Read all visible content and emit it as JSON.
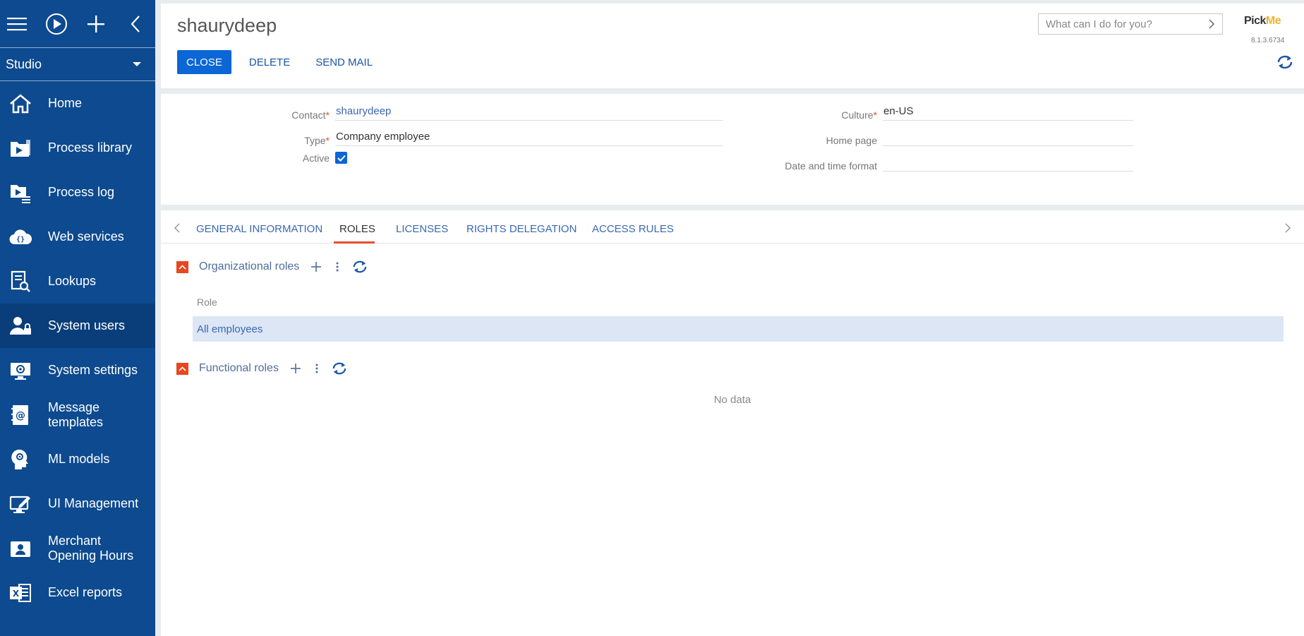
{
  "sidebar": {
    "studio_label": "Studio",
    "items": [
      {
        "label": "Home",
        "icon": "home-icon"
      },
      {
        "label": "Process library",
        "icon": "process-library-icon"
      },
      {
        "label": "Process log",
        "icon": "process-log-icon"
      },
      {
        "label": "Web services",
        "icon": "web-services-icon"
      },
      {
        "label": "Lookups",
        "icon": "lookups-icon"
      },
      {
        "label": "System users",
        "icon": "system-users-icon"
      },
      {
        "label": "System settings",
        "icon": "system-settings-icon"
      },
      {
        "label": "Message\ntemplates",
        "icon": "message-templates-icon"
      },
      {
        "label": "ML models",
        "icon": "ml-models-icon"
      },
      {
        "label": "UI Management",
        "icon": "ui-management-icon"
      },
      {
        "label": "Merchant\nOpening Hours",
        "icon": "merchant-hours-icon"
      },
      {
        "label": "Excel reports",
        "icon": "excel-reports-icon"
      }
    ],
    "active_item": "System users"
  },
  "header": {
    "title": "shaurydeep",
    "close_label": "CLOSE",
    "delete_label": "DELETE",
    "send_mail_label": "SEND MAIL",
    "search_placeholder": "What can I do for you?",
    "brand_prefix": "Pick",
    "brand_suffix": "Me",
    "version": "8.1.3.6734"
  },
  "form": {
    "contact_label": "Contact",
    "contact_value": "shaurydeep",
    "type_label": "Type",
    "type_value": "Company employee",
    "active_label": "Active",
    "active_checked": true,
    "culture_label": "Culture",
    "culture_value": "en-US",
    "home_page_label": "Home page",
    "home_page_value": "",
    "datetime_label": "Date and time format",
    "datetime_value": "",
    "required_mark": "*"
  },
  "tabs": {
    "items": [
      "GENERAL INFORMATION",
      "ROLES",
      "LICENSES",
      "RIGHTS DELEGATION",
      "ACCESS RULES"
    ],
    "active": "ROLES"
  },
  "roles": {
    "org_title": "Organizational roles",
    "org_column": "Role",
    "org_rows": [
      "All employees"
    ],
    "func_title": "Functional roles",
    "func_empty": "No data"
  },
  "colors": {
    "sidebar_bg": "#0d4a8f",
    "accent": "#0b66d6",
    "tab_underline": "#e0502e",
    "section_toggle": "#e8461f",
    "selected_row": "#dce6f5"
  }
}
